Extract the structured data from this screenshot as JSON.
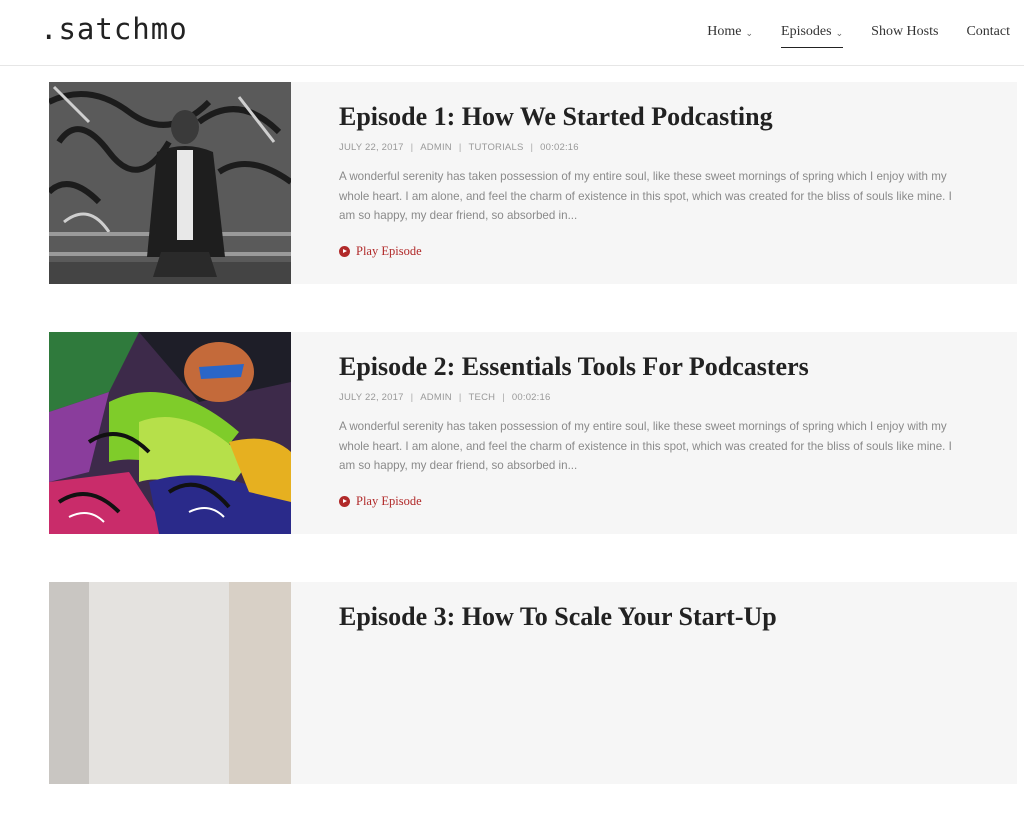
{
  "header": {
    "logo": ".satchmo",
    "nav": [
      {
        "label": "Home",
        "has_dropdown": true,
        "active": false
      },
      {
        "label": "Episodes",
        "has_dropdown": true,
        "active": true
      },
      {
        "label": "Show Hosts",
        "has_dropdown": false,
        "active": false
      },
      {
        "label": "Contact",
        "has_dropdown": false,
        "active": false
      }
    ]
  },
  "episodes": [
    {
      "title": "Episode 1: How We Started Podcasting",
      "date": "JULY 22, 2017",
      "author": "ADMIN",
      "category": "TUTORIALS",
      "duration": "00:02:16",
      "excerpt": "A wonderful serenity has taken possession of my entire soul, like these sweet mornings of spring which I enjoy with my whole heart. I am alone, and feel the charm of existence in this spot, which was created for the bliss of souls like mine. I am so happy, my dear friend, so absorbed in...",
      "play_label": "Play Episode"
    },
    {
      "title": "Episode 2: Essentials Tools For Podcasters",
      "date": "JULY 22, 2017",
      "author": "ADMIN",
      "category": "TECH",
      "duration": "00:02:16",
      "excerpt": "A wonderful serenity has taken possession of my entire soul, like these sweet mornings of spring which I enjoy with my whole heart. I am alone, and feel the charm of existence in this spot, which was created for the bliss of souls like mine. I am so happy, my dear friend, so absorbed in...",
      "play_label": "Play Episode"
    },
    {
      "title": "Episode 3: How To Scale Your Start-Up",
      "date": "",
      "author": "",
      "category": "",
      "duration": "",
      "excerpt": "",
      "play_label": ""
    }
  ],
  "colors": {
    "accent": "#b12a2a",
    "card_bg": "#f6f6f6",
    "text_dark": "#222222",
    "text_muted": "#8a8a8a"
  }
}
